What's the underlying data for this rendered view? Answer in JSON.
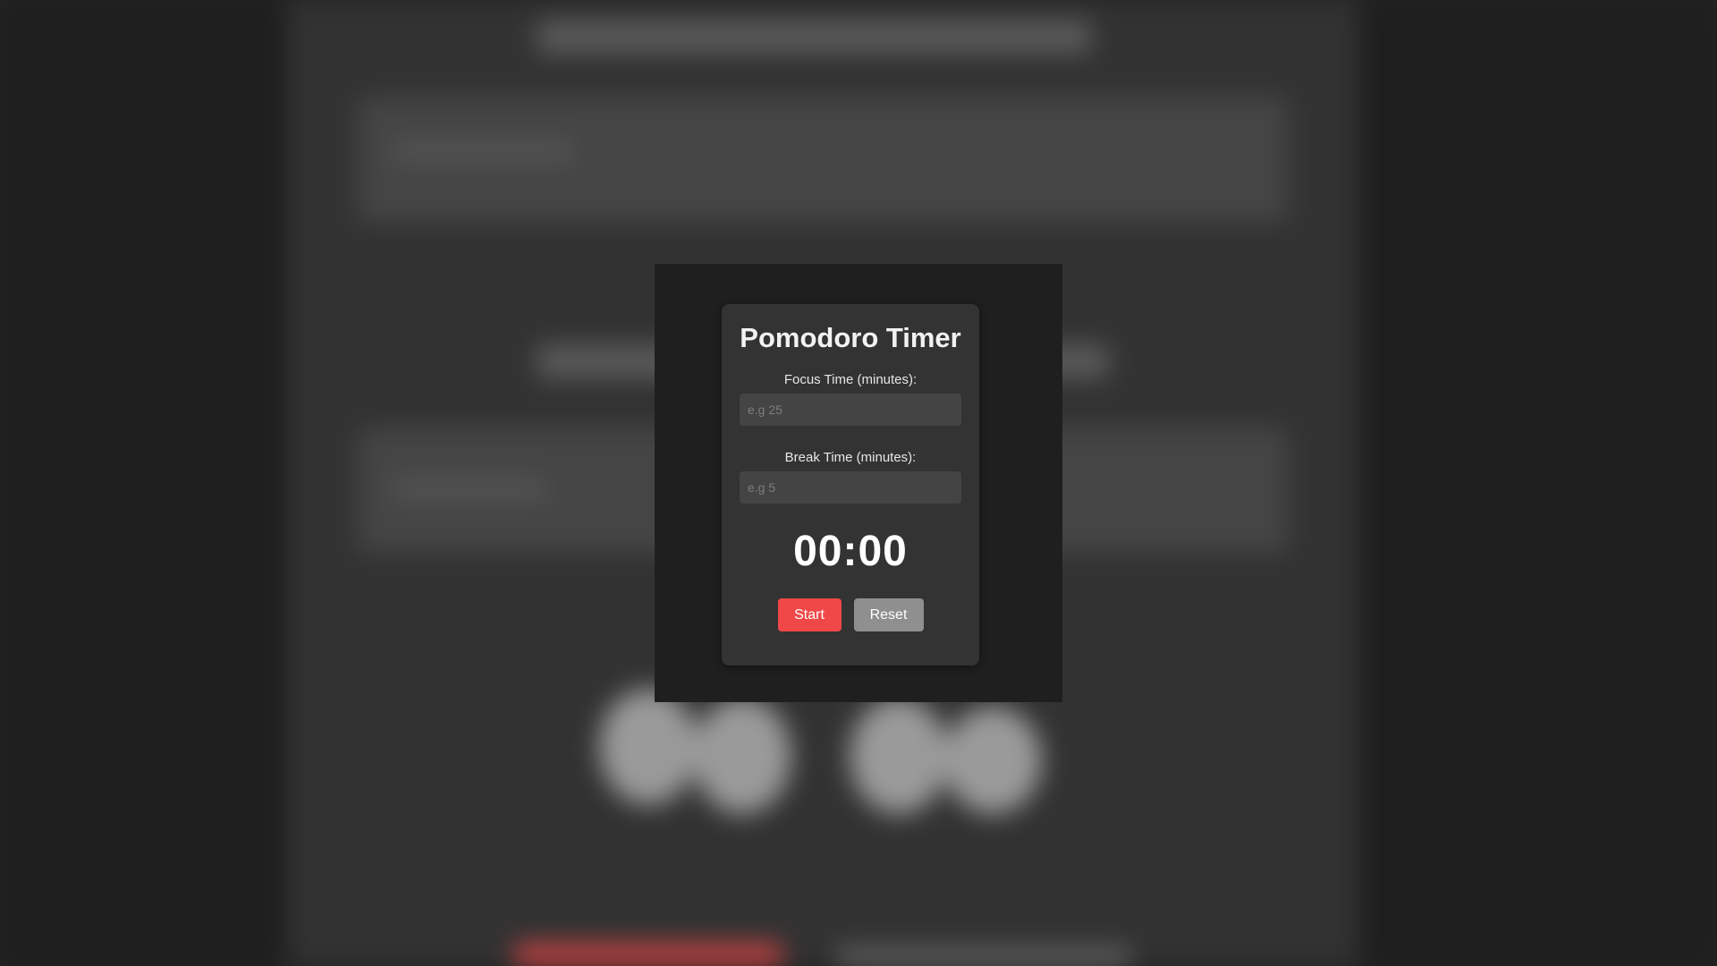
{
  "modal": {
    "title": "Pomodoro Timer",
    "focus": {
      "label": "Focus Time (minutes):",
      "value": "",
      "placeholder": "e.g 25"
    },
    "break": {
      "label": "Break Time (minutes):",
      "value": "",
      "placeholder": "e.g 5"
    },
    "timer": "00:00",
    "buttons": {
      "start": "Start",
      "reset": "Reset"
    }
  },
  "colors": {
    "page_background": "#242424",
    "modal_backdrop": "#1f1f1f",
    "card_background": "#333333",
    "input_background": "#444444",
    "start_button": "#f04848",
    "reset_button": "#8f8f8f",
    "text": "#ffffff"
  }
}
